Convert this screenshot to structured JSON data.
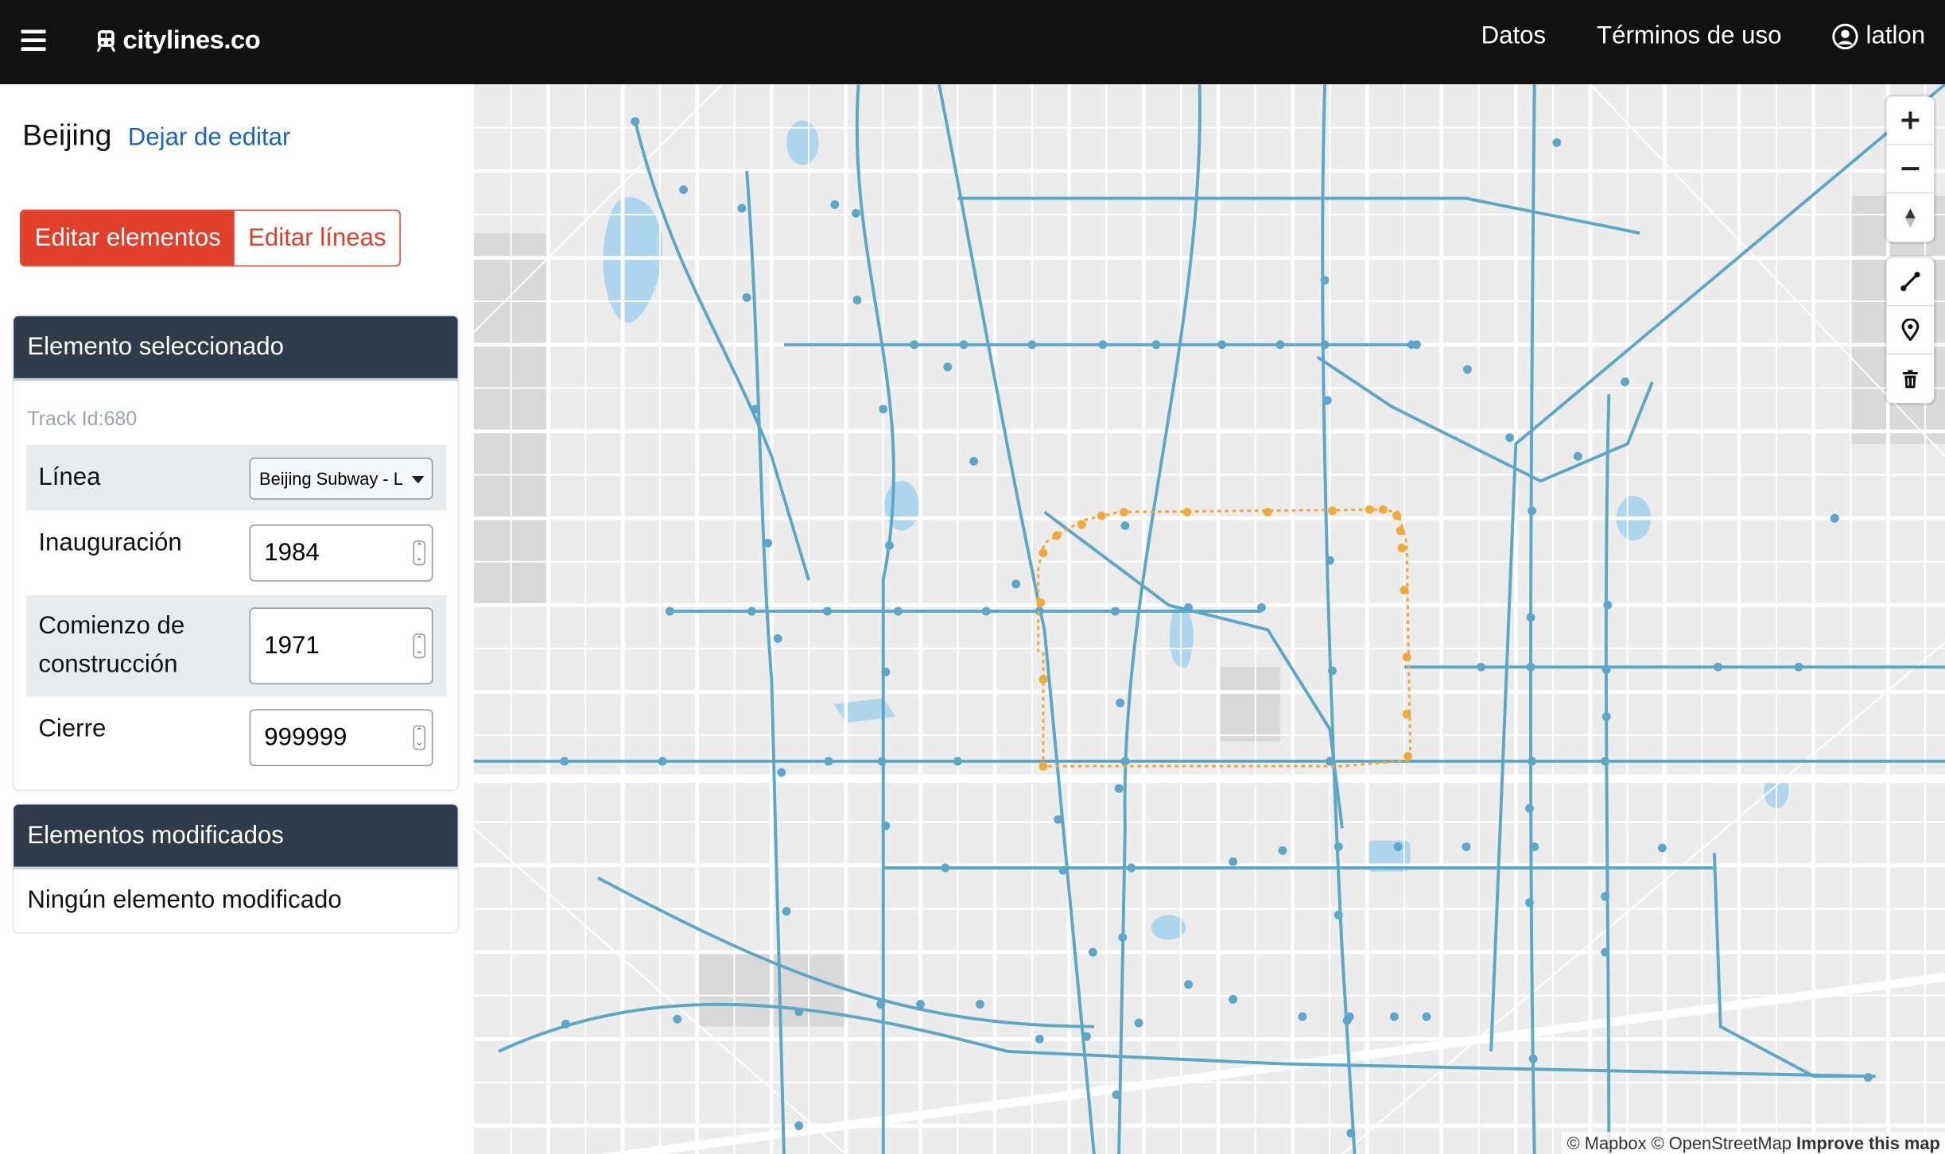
{
  "topbar": {
    "brand": "citylines.co",
    "nav": {
      "data": "Datos",
      "terms": "Términos de uso",
      "user": "latlon"
    }
  },
  "sidebar": {
    "city": "Beijing",
    "stop_edit": "Dejar de editar",
    "tabs": {
      "edit_features": "Editar elementos",
      "edit_lines": "Editar líneas"
    },
    "selected": {
      "title": "Elemento seleccionado",
      "track_id": "Track Id:680",
      "fields": {
        "line_label": "Línea",
        "line_value": "Beijing Subway - L",
        "opening_label": "Inauguración",
        "opening_value": "1984",
        "buildstart_label1": "Comienzo de",
        "buildstart_label2": "construcción",
        "buildstart_value": "1971",
        "closure_label": "Cierre",
        "closure_value": "999999"
      }
    },
    "modified": {
      "title": "Elementos modificados",
      "empty": "Ningún elemento modificado"
    }
  },
  "map": {
    "attribution": {
      "mapbox": "© Mapbox",
      "osm": "© OpenStreetMap",
      "improve": "Improve this map"
    },
    "colors": {
      "line": "#5aa7c9",
      "selected": "#f2a93b",
      "background": "#ececec",
      "road": "#ffffff",
      "water": "#a9d4ee"
    },
    "icons": [
      "zoom-in-icon",
      "zoom-out-icon",
      "compass-icon",
      "draw-line-icon",
      "draw-point-icon",
      "trash-icon"
    ]
  }
}
